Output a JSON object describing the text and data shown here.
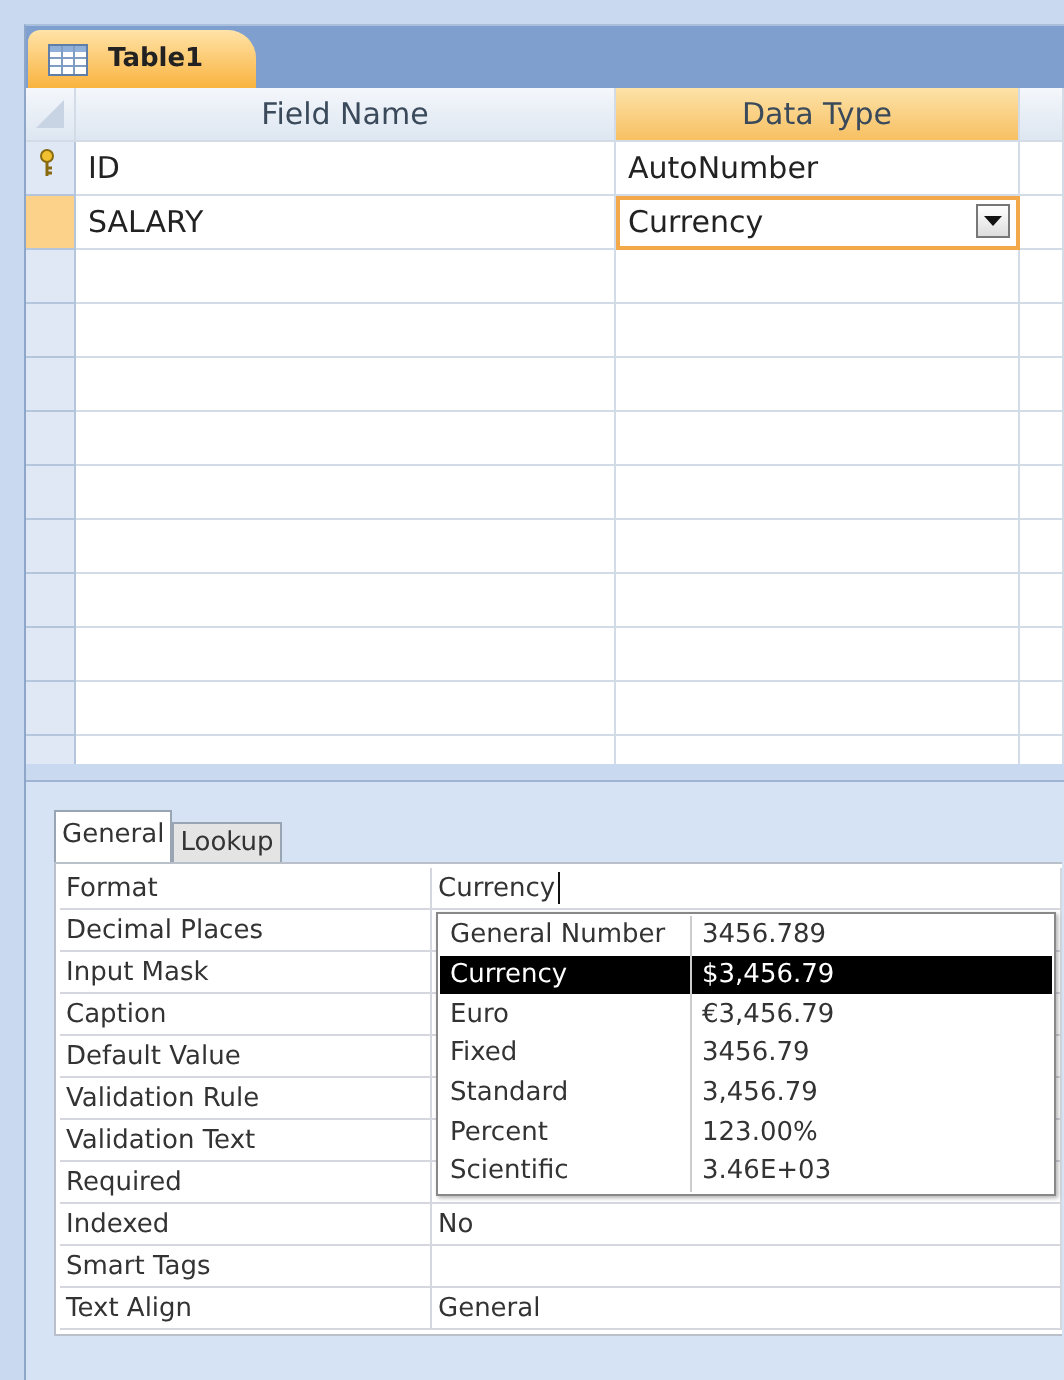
{
  "document_tab": {
    "label": "Table1",
    "selected": true
  },
  "grid": {
    "columns": [
      {
        "label": "Field Name",
        "selected": false
      },
      {
        "label": "Data Type",
        "selected": true
      }
    ],
    "rows": [
      {
        "field_name": "ID",
        "data_type": "AutoNumber",
        "primary_key": true,
        "selected": false
      },
      {
        "field_name": "SALARY",
        "data_type": "Currency",
        "primary_key": false,
        "selected": true
      }
    ]
  },
  "property_tabs": [
    {
      "label": "General",
      "selected": true
    },
    {
      "label": "Lookup",
      "selected": false
    }
  ],
  "properties": [
    {
      "label": "Format",
      "value": "Currency"
    },
    {
      "label": "Decimal Places"
    },
    {
      "label": "Input Mask"
    },
    {
      "label": "Caption"
    },
    {
      "label": "Default Value"
    },
    {
      "label": "Validation Rule"
    },
    {
      "label": "Validation Text"
    },
    {
      "label": "Required"
    },
    {
      "label": "Indexed",
      "value": "No"
    },
    {
      "label": "Smart Tags"
    },
    {
      "label": "Text Align",
      "value": "General"
    }
  ],
  "format_dropdown": {
    "options": [
      {
        "name": "General Number",
        "sample": "3456.789",
        "selected": false
      },
      {
        "name": "Currency",
        "sample": "$3,456.79",
        "selected": true
      },
      {
        "name": "Euro",
        "sample": "€3,456.79",
        "selected": false
      },
      {
        "name": "Fixed",
        "sample": "3456.79",
        "selected": false
      },
      {
        "name": "Standard",
        "sample": "3,456.79",
        "selected": false
      },
      {
        "name": "Percent",
        "sample": "123.00%",
        "selected": false
      },
      {
        "name": "Scientific",
        "sample": "3.46E+03",
        "selected": false
      }
    ]
  }
}
